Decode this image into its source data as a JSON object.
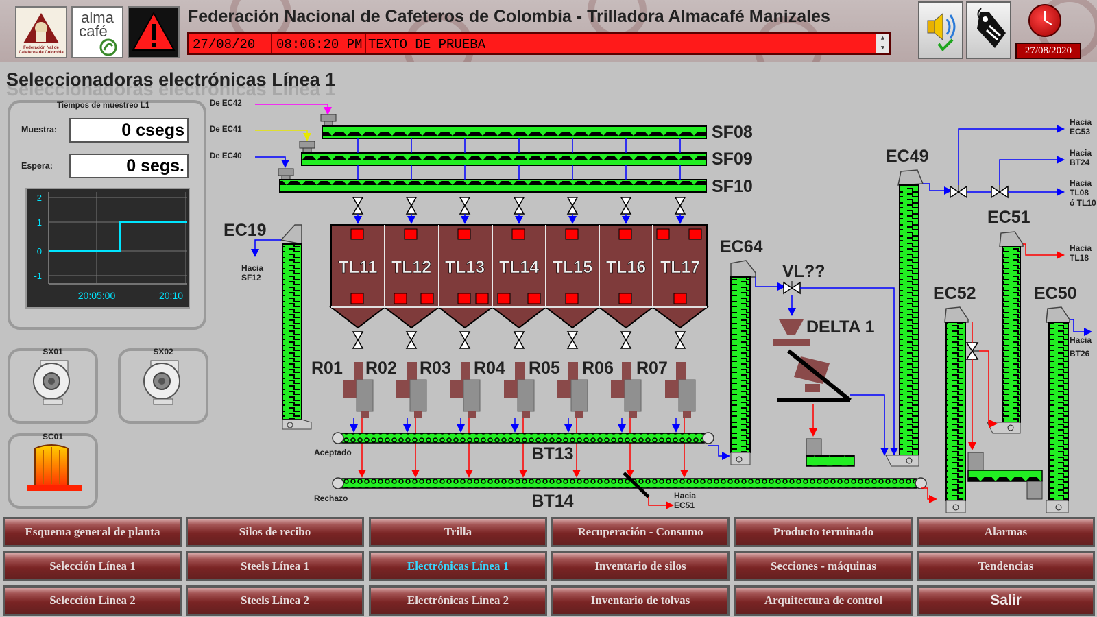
{
  "header": {
    "title": "Federación Nacional de Cafeteros de Colombia  - Trilladora Almacafé Manizales",
    "logo_fnc_text": "Federación Nacional de Cafeteros de Colombia",
    "logo_alma_text": "alma café",
    "alarm": {
      "date": "27/08/20",
      "time": "08:06:20 PM",
      "message": "TEXTO DE PRUEBA",
      "color": "#ff1a1a"
    },
    "date": "27/08/2020"
  },
  "page_title": "Seleccionadoras electrónicas Línea 1",
  "sampling": {
    "caption": "Tiempos de muestreo L1",
    "muestra_label": "Muestra:",
    "muestra_value": "0 csegs",
    "espera_label": "Espera:",
    "espera_value": "0 segs.",
    "trend": {
      "y_ticks": [
        "2",
        "1",
        "0",
        "-1"
      ],
      "x_ticks": [
        "20:05:00",
        "20:10"
      ],
      "series_color": "#00e5ff"
    }
  },
  "equipment": {
    "sx01": "SX01",
    "sx02": "SX02",
    "sc01": "SC01"
  },
  "diagram": {
    "sources": [
      "De  EC42",
      "De  EC41",
      "De  EC40"
    ],
    "conveyors": [
      "SF08",
      "SF09",
      "SF10"
    ],
    "hoppers": [
      "TL11",
      "TL12",
      "TL13",
      "TL14",
      "TL15",
      "TL16",
      "TL17"
    ],
    "sorters": [
      "R01",
      "R02",
      "R03",
      "R04",
      "R05",
      "R06",
      "R07"
    ],
    "elevators": {
      "ec19": "EC19",
      "ec64": "EC64",
      "ec49": "EC49",
      "ec51": "EC51",
      "ec52": "EC52",
      "ec50": "EC50"
    },
    "valve": "VL??",
    "delta": "DELTA 1",
    "belts": {
      "bt13": "BT13",
      "bt14": "BT14",
      "aceptado": "Aceptado",
      "rechazo": "Rechazo"
    },
    "hacia_sf12": [
      "Hacia",
      "SF12"
    ],
    "hacia_ec51": [
      "Hacia",
      "EC51"
    ],
    "hacia_ec53": [
      "Hacia",
      "EC53"
    ],
    "hacia_bt24": [
      "Hacia",
      "BT24"
    ],
    "hacia_tl08": [
      "Hacia",
      "TL08",
      "ó TL10"
    ],
    "hacia_tl18": [
      "Hacia",
      "TL18"
    ],
    "hacia_bt26": [
      "Hacia",
      "BT26"
    ]
  },
  "nav": {
    "row1": [
      "Esquema general de planta",
      "Silos de recibo",
      "Trilla",
      "Recuperación - Consumo",
      "Producto terminado",
      "Alarmas"
    ],
    "row2": [
      "Selección Línea 1",
      "Steels Línea 1",
      "Electrónicas Línea 1",
      "Inventario de silos",
      "Secciones - máquinas",
      "Tendencias"
    ],
    "row3": [
      "Selección Línea 2",
      "Steels Línea 2",
      "Electrónicas Línea 2",
      "Inventario de tolvas",
      "Arquitectura de control",
      "Salir"
    ]
  },
  "colors": {
    "conveyor": "#22ee22",
    "hopper": "#7f3b3b",
    "flow_blue": "#0000ff",
    "flow_red": "#ff0000",
    "flow_magenta": "#ff00ff",
    "flow_yellow": "#ffff00"
  }
}
